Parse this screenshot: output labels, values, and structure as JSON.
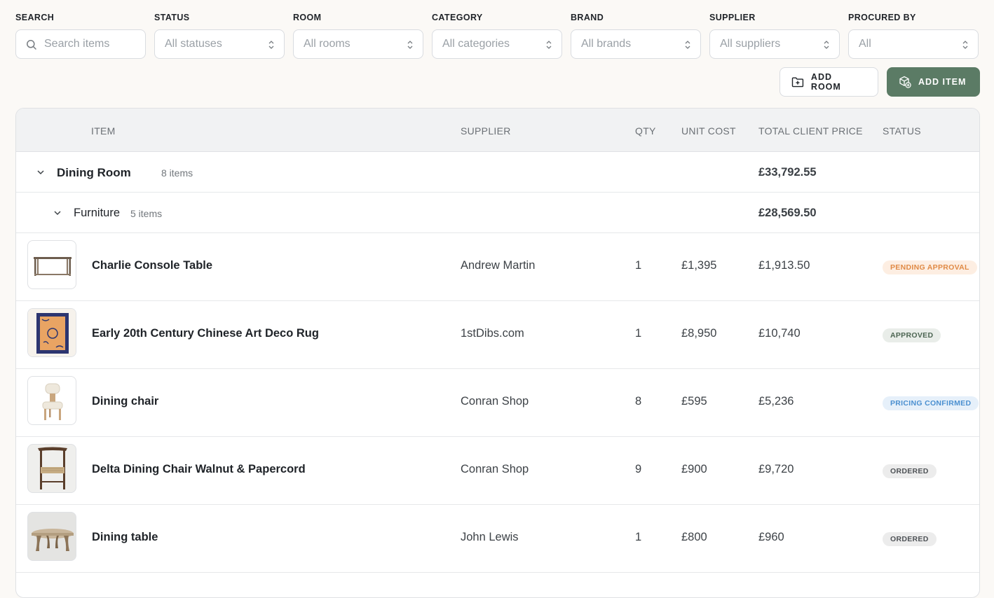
{
  "filters": [
    {
      "label": "SEARCH",
      "placeholder": "Search items"
    },
    {
      "label": "STATUS",
      "placeholder": "All statuses"
    },
    {
      "label": "ROOM",
      "placeholder": "All rooms"
    },
    {
      "label": "CATEGORY",
      "placeholder": "All categories"
    },
    {
      "label": "BRAND",
      "placeholder": "All brands"
    },
    {
      "label": "SUPPLIER",
      "placeholder": "All suppliers"
    },
    {
      "label": "PROCURED BY",
      "placeholder": "All"
    }
  ],
  "actions": {
    "add_room": "ADD ROOM",
    "add_item": "ADD ITEM"
  },
  "table": {
    "headers": {
      "item": "ITEM",
      "supplier": "SUPPLIER",
      "qty": "QTY",
      "unit_cost": "UNIT COST",
      "total_client_price": "TOTAL CLIENT PRICE",
      "status": "STATUS"
    },
    "room": {
      "name": "Dining Room",
      "count": "8 items",
      "total": "£33,792.55"
    },
    "category": {
      "name": "Furniture",
      "count": "5 items",
      "total": "£28,569.50"
    },
    "rows": [
      {
        "name": "Charlie Console Table",
        "supplier": "Andrew Martin",
        "qty": "1",
        "unit_cost": "£1,395",
        "total": "£1,913.50",
        "status": "PENDING APPROVAL",
        "thumb": "console-table-icon"
      },
      {
        "name": "Early 20th Century Chinese Art Deco Rug",
        "supplier": "1stDibs.com",
        "qty": "1",
        "unit_cost": "£8,950",
        "total": "£10,740",
        "status": "APPROVED",
        "thumb": "rug-icon"
      },
      {
        "name": "Dining chair",
        "supplier": "Conran Shop",
        "qty": "8",
        "unit_cost": "£595",
        "total": "£5,236",
        "status": "PRICING CONFIRMED",
        "thumb": "chair-icon"
      },
      {
        "name": "Delta Dining Chair Walnut & Papercord",
        "supplier": "Conran Shop",
        "qty": "9",
        "unit_cost": "£900",
        "total": "£9,720",
        "status": "ORDERED",
        "thumb": "walnut-chair-icon"
      },
      {
        "name": "Dining table",
        "supplier": "John Lewis",
        "qty": "1",
        "unit_cost": "£800",
        "total": "£960",
        "status": "ORDERED",
        "thumb": "dining-table-icon"
      }
    ]
  },
  "status_colors": {
    "PENDING APPROVAL": {
      "bg": "#fdeee2",
      "fg": "#e08a45"
    },
    "APPROVED": {
      "bg": "#e9ede9",
      "fg": "#4c6552"
    },
    "PRICING CONFIRMED": {
      "bg": "#e6f0fa",
      "fg": "#4a8fd0"
    },
    "ORDERED": {
      "bg": "#ececec",
      "fg": "#4f5357"
    }
  },
  "colors": {
    "accent": "#5b7b65"
  }
}
